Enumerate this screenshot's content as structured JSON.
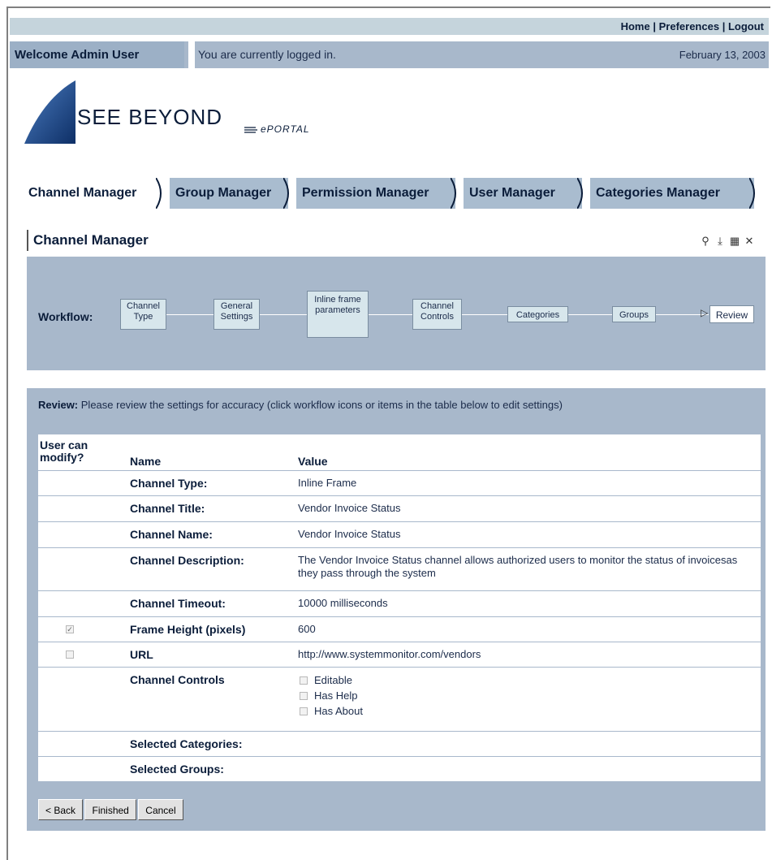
{
  "top_links": {
    "home": "Home",
    "preferences": "Preferences",
    "logout": "Logout",
    "separator": "|"
  },
  "welcome": {
    "name": "Welcome Admin User",
    "status": "You are currently logged in.",
    "date": "February 13, 2003"
  },
  "logo": {
    "text": "SEE BEYOND",
    "sub": "ePORTAL"
  },
  "tabs": [
    {
      "label": "Channel Manager",
      "active": true
    },
    {
      "label": "Group Manager",
      "active": false
    },
    {
      "label": "Permission Manager",
      "active": false
    },
    {
      "label": "User Manager",
      "active": false
    },
    {
      "label": "Categories Manager",
      "active": false
    }
  ],
  "section_title": "Channel Manager",
  "portlet_icons": [
    "search-icon",
    "download-icon",
    "edit-icon",
    "close-icon"
  ],
  "workflow": {
    "label": "Workflow:",
    "steps": [
      {
        "label": "Channel Type"
      },
      {
        "label": "General Settings"
      },
      {
        "label": "Inline frame parameters"
      },
      {
        "label": "Channel Controls"
      },
      {
        "label": "Categories"
      },
      {
        "label": "Groups"
      },
      {
        "label": "Review"
      }
    ]
  },
  "review": {
    "heading": "Review:",
    "message": "Please review the settings for accuracy (click workflow icons or items in the table below to edit settings)"
  },
  "table": {
    "headers": {
      "modify": "User can modify?",
      "name": "Name",
      "value": "Value"
    },
    "rows": [
      {
        "name": "Channel Type:",
        "value": "Inline Frame"
      },
      {
        "name": "Channel Title:",
        "value": "Vendor Invoice Status"
      },
      {
        "name": "Channel Name:",
        "value": "Vendor Invoice Status"
      },
      {
        "name": "Channel Description:",
        "value": "The Vendor Invoice Status channel allows authorized users to monitor the status of invoicesas they pass through the system"
      },
      {
        "name": "Channel Timeout:",
        "value": "10000 milliseconds"
      },
      {
        "name": "Frame Height (pixels)",
        "value": "600",
        "modify": true
      },
      {
        "name": "URL",
        "value": "http://www.systemmonitor.com/vendors",
        "modify": false
      },
      {
        "name": "Channel Controls",
        "controls": [
          "Editable",
          "Has Help",
          "Has About"
        ]
      },
      {
        "name": "Selected Categories:",
        "value": ""
      },
      {
        "name": "Selected Groups:",
        "value": ""
      }
    ]
  },
  "buttons": {
    "back": "< Back",
    "finished": "Finished",
    "cancel": "Cancel"
  },
  "colors": {
    "nav_bg": "#a8b8cb",
    "top_bar": "#c5d4dc",
    "text_dark": "#0b1d3a",
    "logo_blue": "#1f4f8f"
  }
}
